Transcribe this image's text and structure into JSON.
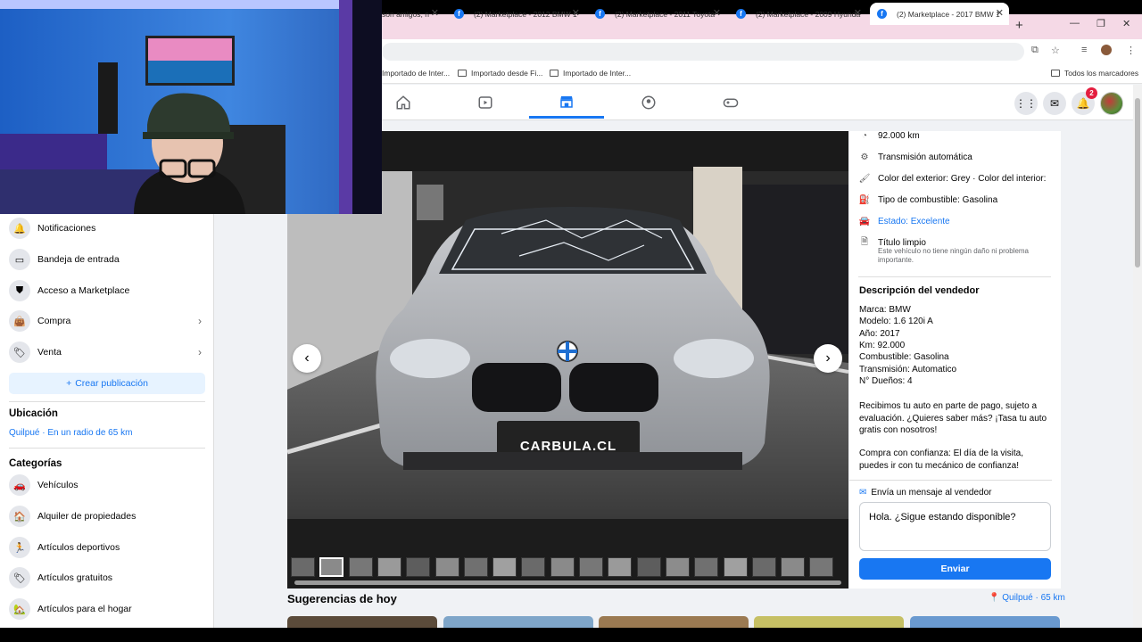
{
  "browser": {
    "tabs": [
      {
        "label": "son amigos, n",
        "active": false
      },
      {
        "label": "(2) Marketplace - 2012 BMW 1",
        "active": false
      },
      {
        "label": "(2) Marketplace - 2011 Toyota",
        "active": false
      },
      {
        "label": "(2) Marketplace - 2009 Hyunda",
        "active": false
      },
      {
        "label": "(2) Marketplace - 2017 BMW 1",
        "active": true
      }
    ],
    "bookmarks": [
      "Importado de Inter...",
      "Importado desde Fi...",
      "Importado de Inter..."
    ],
    "all_bookmarks": "Todos los marcadores"
  },
  "fb_nav": {
    "notification_count": "2",
    "icons": [
      "home-icon",
      "video-icon",
      "marketplace-icon",
      "groups-icon",
      "gaming-icon"
    ]
  },
  "sidebar": {
    "items": [
      {
        "label": "Notificaciones",
        "icon": "bell"
      },
      {
        "label": "Bandeja de entrada",
        "icon": "inbox"
      },
      {
        "label": "Acceso a Marketplace",
        "icon": "shield"
      },
      {
        "label": "Compra",
        "icon": "bag"
      },
      {
        "label": "Venta",
        "icon": "tag"
      }
    ],
    "create_label": "Crear publicación",
    "location_heading": "Ubicación",
    "location_value": "Quilpué · En un radio de 65 km",
    "categories_heading": "Categorías",
    "categories": [
      {
        "label": "Vehículos"
      },
      {
        "label": "Alquiler de propiedades"
      },
      {
        "label": "Artículos deportivos"
      },
      {
        "label": "Artículos gratuitos"
      },
      {
        "label": "Artículos para el hogar"
      }
    ]
  },
  "listing": {
    "plate_text": "CARBULA.CL",
    "details": [
      {
        "text": "92.000 km"
      },
      {
        "text": "Transmisión automática"
      },
      {
        "text": "Color del exterior: Grey · Color del interior:"
      },
      {
        "text": "Tipo de combustible: Gasolina"
      },
      {
        "text": "Estado: Excelente"
      },
      {
        "text": "Título limpio"
      }
    ],
    "title_note": "Este vehículo no tiene ningún daño ni problema importante.",
    "seller_heading": "Descripción del vendedor",
    "seller_lines": [
      "Marca: BMW",
      "Modelo: 1.6 120i A",
      "Año: 2017",
      "Km: 92.000",
      "Combustible: Gasolina",
      "Transmisión: Automatico",
      "N° Dueños: 4"
    ],
    "para1": "Recibimos tu auto en parte de pago, sujeto a evaluación. ¿Quieres saber más? ¡Tasa tu auto gratis con nosotros!",
    "para2": "Compra con confianza: El día de la visita, puedes ir con tu mecánico de confianza!",
    "message_heading": "Envía un mensaje al vendedor",
    "message_value": "Hola. ¿Sigue estando disponible?",
    "send_label": "Enviar"
  },
  "suggestions": {
    "title": "Sugerencias de hoy",
    "location": "Quilpué · 65 km"
  }
}
